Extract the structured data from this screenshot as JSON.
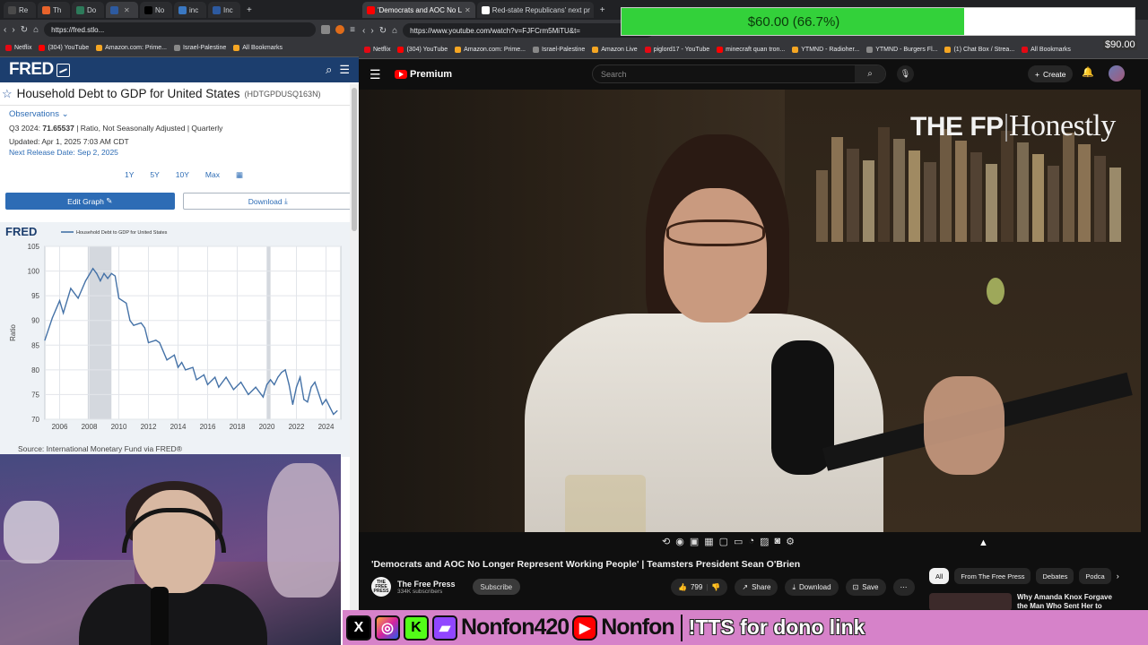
{
  "left_browser": {
    "tabs": [
      {
        "label": "Re",
        "color": "#4a4a4a"
      },
      {
        "label": "Th",
        "color": "#e8632b"
      },
      {
        "label": "Do",
        "color": "#2d7a5a"
      },
      {
        "label": "",
        "color": "#2d5aa0",
        "active": true
      },
      {
        "label": "No",
        "color": "#000000"
      },
      {
        "label": "inc",
        "color": "#3a78c2"
      },
      {
        "label": "Inc",
        "color": "#2d5aa0"
      }
    ],
    "address": "https://fred.stlo...",
    "bookmarks": [
      "Netflix",
      "(304) YouTube",
      "Amazon.com: Prime...",
      "Israel-Palestine",
      "All Bookmarks"
    ]
  },
  "fred": {
    "logo": "FRED",
    "series_title": "Household Debt to GDP for United States",
    "series_id": "(HDTGPDUSQ163N)",
    "observations_label": "Observations",
    "obs_period": "Q3 2024:",
    "obs_value": "71.65537",
    "obs_units": "| Ratio, Not Seasonally Adjusted | Quarterly",
    "updated": "Updated: Apr 1, 2025 7:03 AM CDT",
    "next_release": "Next Release Date: Sep 2, 2025",
    "ranges": [
      "1Y",
      "5Y",
      "10Y",
      "Max"
    ],
    "edit_graph": "Edit Graph",
    "download": "Download",
    "source": "Source: International Monetary Fund via FRED®"
  },
  "chart_data": {
    "type": "line",
    "legend_logo": "FRED",
    "series": [
      {
        "name": "Household Debt to GDP for United States",
        "points": [
          [
            2005.0,
            86
          ],
          [
            2005.5,
            90.5
          ],
          [
            2006.0,
            94
          ],
          [
            2006.25,
            91.5
          ],
          [
            2006.75,
            96.5
          ],
          [
            2007.25,
            94.5
          ],
          [
            2007.75,
            98
          ],
          [
            2008.25,
            100.5
          ],
          [
            2008.5,
            99.5
          ],
          [
            2008.75,
            98
          ],
          [
            2009.0,
            99.5
          ],
          [
            2009.25,
            98.5
          ],
          [
            2009.5,
            99.5
          ],
          [
            2009.75,
            99
          ],
          [
            2010.0,
            94.5
          ],
          [
            2010.5,
            93.5
          ],
          [
            2010.75,
            90
          ],
          [
            2011.0,
            89
          ],
          [
            2011.5,
            89.5
          ],
          [
            2011.75,
            88.5
          ],
          [
            2012.0,
            85.5
          ],
          [
            2012.5,
            86
          ],
          [
            2012.75,
            85.5
          ],
          [
            2013.25,
            82
          ],
          [
            2013.75,
            83
          ],
          [
            2014.0,
            80.5
          ],
          [
            2014.25,
            81.5
          ],
          [
            2014.5,
            80
          ],
          [
            2015.0,
            80.5
          ],
          [
            2015.25,
            78
          ],
          [
            2015.75,
            79
          ],
          [
            2016.0,
            77
          ],
          [
            2016.5,
            78.5
          ],
          [
            2016.75,
            76.5
          ],
          [
            2017.25,
            78.5
          ],
          [
            2017.75,
            76
          ],
          [
            2018.25,
            77.5
          ],
          [
            2018.75,
            75
          ],
          [
            2019.25,
            76.5
          ],
          [
            2019.75,
            74.5
          ],
          [
            2020.0,
            77
          ],
          [
            2020.25,
            78
          ],
          [
            2020.5,
            77
          ],
          [
            2020.75,
            78.5
          ],
          [
            2021.0,
            79.5
          ],
          [
            2021.25,
            80
          ],
          [
            2021.5,
            77
          ],
          [
            2021.75,
            73
          ],
          [
            2022.0,
            76.5
          ],
          [
            2022.25,
            78.5
          ],
          [
            2022.5,
            74
          ],
          [
            2022.75,
            73.5
          ],
          [
            2023.0,
            76.5
          ],
          [
            2023.25,
            77.5
          ],
          [
            2023.75,
            73
          ],
          [
            2024.0,
            74
          ],
          [
            2024.25,
            72.5
          ],
          [
            2024.5,
            71
          ],
          [
            2024.75,
            71.7
          ]
        ]
      }
    ],
    "xlim": [
      2005.0,
      2025.0
    ],
    "ylim": [
      70,
      105
    ],
    "xticks": [
      2006,
      2008,
      2010,
      2012,
      2014,
      2016,
      2018,
      2020,
      2022,
      2024
    ],
    "yticks": [
      70,
      75,
      80,
      85,
      90,
      95,
      100,
      105
    ],
    "xlabel": "",
    "ylabel": "Ratio",
    "recessions": [
      [
        2007.9,
        2009.5
      ],
      [
        2020.0,
        2020.25
      ]
    ],
    "grid": true,
    "line_color": "#4572a7"
  },
  "right_browser": {
    "tabs": [
      {
        "label": "'Democrats and AOC No L",
        "color": "#ff0000",
        "active": true
      },
      {
        "label": "Red-state Republicans' next pr",
        "color": "#ffffff"
      }
    ],
    "address": "https://www.youtube.com/watch?v=FJFCrm5MiTU&t=",
    "bookmarks": [
      "Netflix",
      "(304) YouTube",
      "Amazon.com: Prime...",
      "Israel-Palestine",
      "Amazon Live",
      "piglord17 - YouTube",
      "minecraft quan tron...",
      "YTMND - Radioher...",
      "YTMND - Burgers Fl...",
      "(1) Chat Box / Strea...",
      "All Bookmarks"
    ]
  },
  "youtube": {
    "logo": "Premium",
    "search_placeholder": "Search",
    "create": "Create",
    "video_brand": "Honestly",
    "video_brand_prefix": "THE FP",
    "video_title": "'Democrats and AOC No Longer Represent Working People' | Teamsters President Sean O'Brien",
    "channel_name": "The Free Press",
    "channel_avatar_text": "THE FREE PRESS",
    "subscribers": "334K subscribers",
    "subscribe": "Subscribe",
    "likes": "799",
    "share": "Share",
    "download": "Download",
    "save": "Save",
    "chips": [
      "All",
      "From The Free Press",
      "Debates",
      "Podca"
    ],
    "rec_title": "Why Amanda Knox Forgave the Man Who Sent Her to Prison"
  },
  "donation": {
    "text": "$60.00 (66.7%)",
    "percent": 66.7,
    "goal": "$90.00"
  },
  "stream_overlay": {
    "handle": "Nonfon420",
    "yt_name": "Nonfon",
    "tts": "!TTS for dono link"
  }
}
